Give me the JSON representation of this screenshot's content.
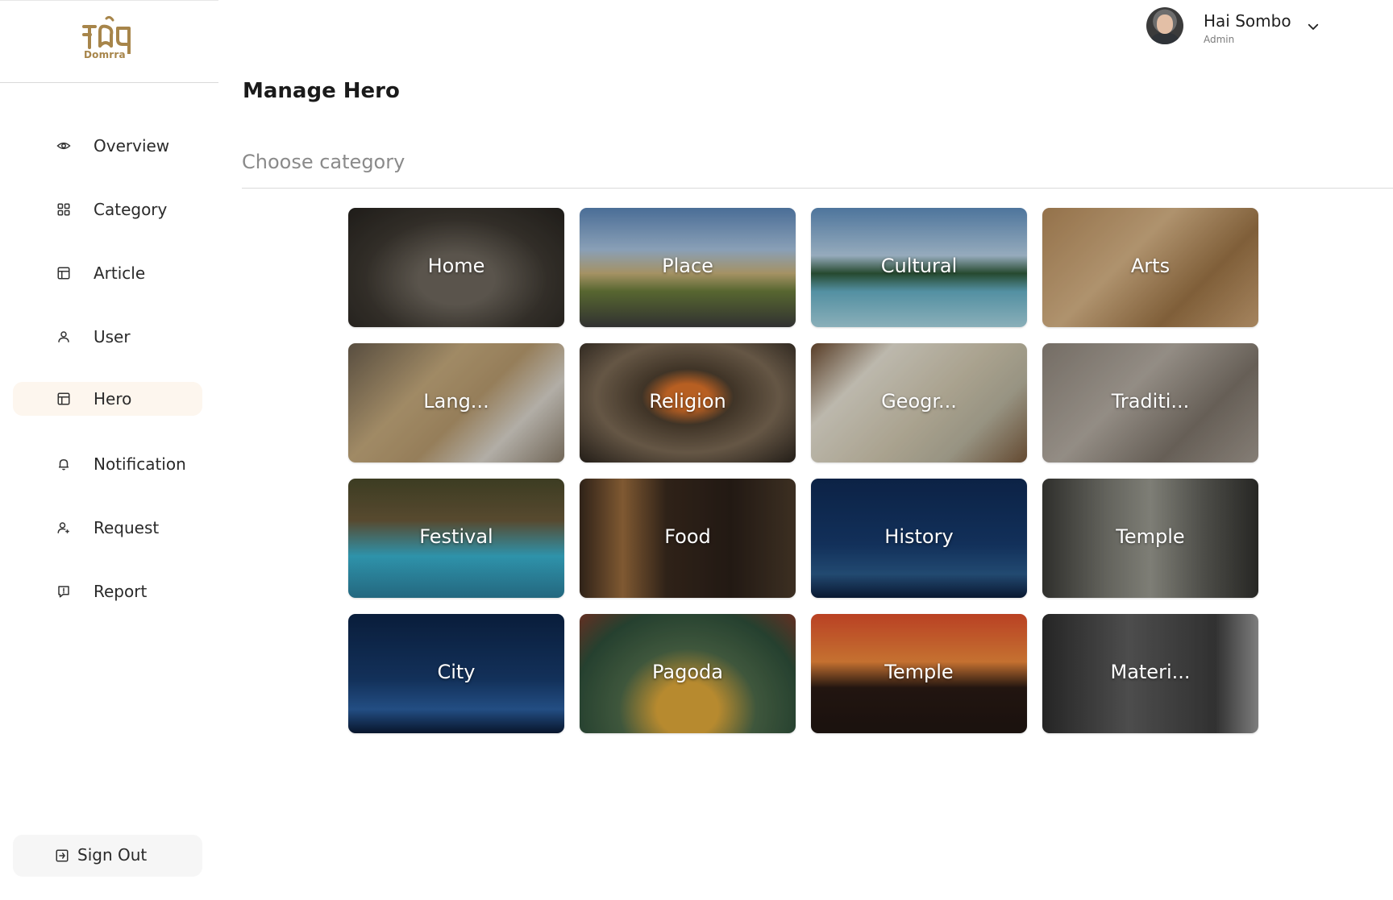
{
  "brand": {
    "logo_text": "Domrra",
    "accent": "#a7854a"
  },
  "sidebar": {
    "items": [
      {
        "label": "Overview",
        "icon": "eye-icon"
      },
      {
        "label": "Category",
        "icon": "grid-icon"
      },
      {
        "label": "Article",
        "icon": "layout-icon"
      },
      {
        "label": "User",
        "icon": "user-icon"
      },
      {
        "label": "Hero",
        "icon": "layout-icon",
        "active": true
      },
      {
        "label": "Notification",
        "icon": "bell-icon"
      },
      {
        "label": "Request",
        "icon": "user-plus-icon"
      },
      {
        "label": "Report",
        "icon": "report-icon"
      }
    ],
    "signout_label": "Sign Out"
  },
  "header": {
    "user_name": "Hai Sombo",
    "user_role": "Admin"
  },
  "main": {
    "title": "Manage Hero",
    "choose_category": "Choose category",
    "cards": [
      {
        "label": "Home"
      },
      {
        "label": "Place"
      },
      {
        "label": "Cultural"
      },
      {
        "label": "Arts"
      },
      {
        "label": "Lang..."
      },
      {
        "label": "Religion"
      },
      {
        "label": "Geogr..."
      },
      {
        "label": "Traditi..."
      },
      {
        "label": "Festival"
      },
      {
        "label": "Food"
      },
      {
        "label": "History"
      },
      {
        "label": "Temple"
      },
      {
        "label": "City"
      },
      {
        "label": "Pagoda"
      },
      {
        "label": "Temple"
      },
      {
        "label": "Materi..."
      }
    ]
  }
}
